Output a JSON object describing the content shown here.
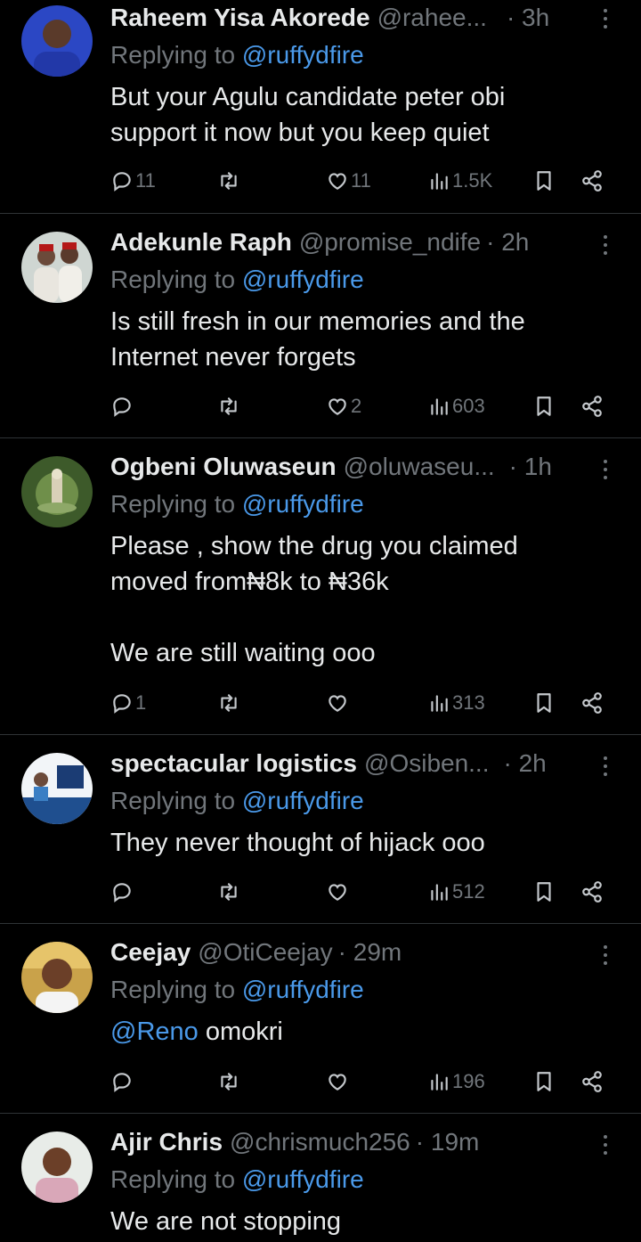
{
  "replies": [
    {
      "name": "Raheem Yisa Akorede",
      "handle": "@rahee...",
      "time": "· 3h",
      "replying_prefix": "Replying to",
      "replying_to": "@ruffydfire",
      "text": "But your Agulu candidate peter obi\nsupport it now but you keep quiet",
      "mention": "",
      "reply_count": "11",
      "repost_count": "",
      "like_count": "11",
      "view_count": "1.5K"
    },
    {
      "name": "Adekunle Raph",
      "handle": "@promise_ndife",
      "time": "· 2h",
      "replying_prefix": "Replying to",
      "replying_to": "@ruffydfire",
      "text": "Is still fresh in our memories and the\nInternet never forgets",
      "mention": "",
      "reply_count": "",
      "repost_count": "",
      "like_count": "2",
      "view_count": "603"
    },
    {
      "name": "Ogbeni Oluwaseun",
      "handle": "@oluwaseu...",
      "time": "· 1h",
      "replying_prefix": "Replying to",
      "replying_to": "@ruffydfire",
      "text": "Please , show the drug you claimed\nmoved from₦8k to ₦36k\n\nWe are still waiting ooo",
      "mention": "",
      "reply_count": "1",
      "repost_count": "",
      "like_count": "",
      "view_count": "313"
    },
    {
      "name": "spectacular logistics",
      "handle": "@Osiben...",
      "time": "· 2h",
      "replying_prefix": "Replying to",
      "replying_to": "@ruffydfire",
      "text": "They never thought of hijack ooo",
      "mention": "",
      "reply_count": "",
      "repost_count": "",
      "like_count": "",
      "view_count": "512"
    },
    {
      "name": "Ceejay",
      "handle": "@OtiCeejay",
      "time": "· 29m",
      "replying_prefix": "Replying to",
      "replying_to": "@ruffydfire",
      "text": " omokri",
      "mention": "@Reno",
      "reply_count": "",
      "repost_count": "",
      "like_count": "",
      "view_count": "196"
    },
    {
      "name": "Ajir Chris",
      "handle": "@chrismuch256",
      "time": "· 19m",
      "replying_prefix": "Replying to",
      "replying_to": "@ruffydfire",
      "text": "We are not stopping",
      "mention": "",
      "reply_count": "",
      "repost_count": "",
      "like_count": "",
      "view_count": ""
    }
  ],
  "colors": {
    "background": "#000000",
    "text": "#e7e9ea",
    "secondary": "#71767b",
    "link": "#4a99e9",
    "divider": "#2f3336"
  },
  "icons": [
    "reply-icon",
    "repost-icon",
    "like-icon",
    "views-icon",
    "bookmark-icon",
    "share-icon",
    "more-icon"
  ]
}
